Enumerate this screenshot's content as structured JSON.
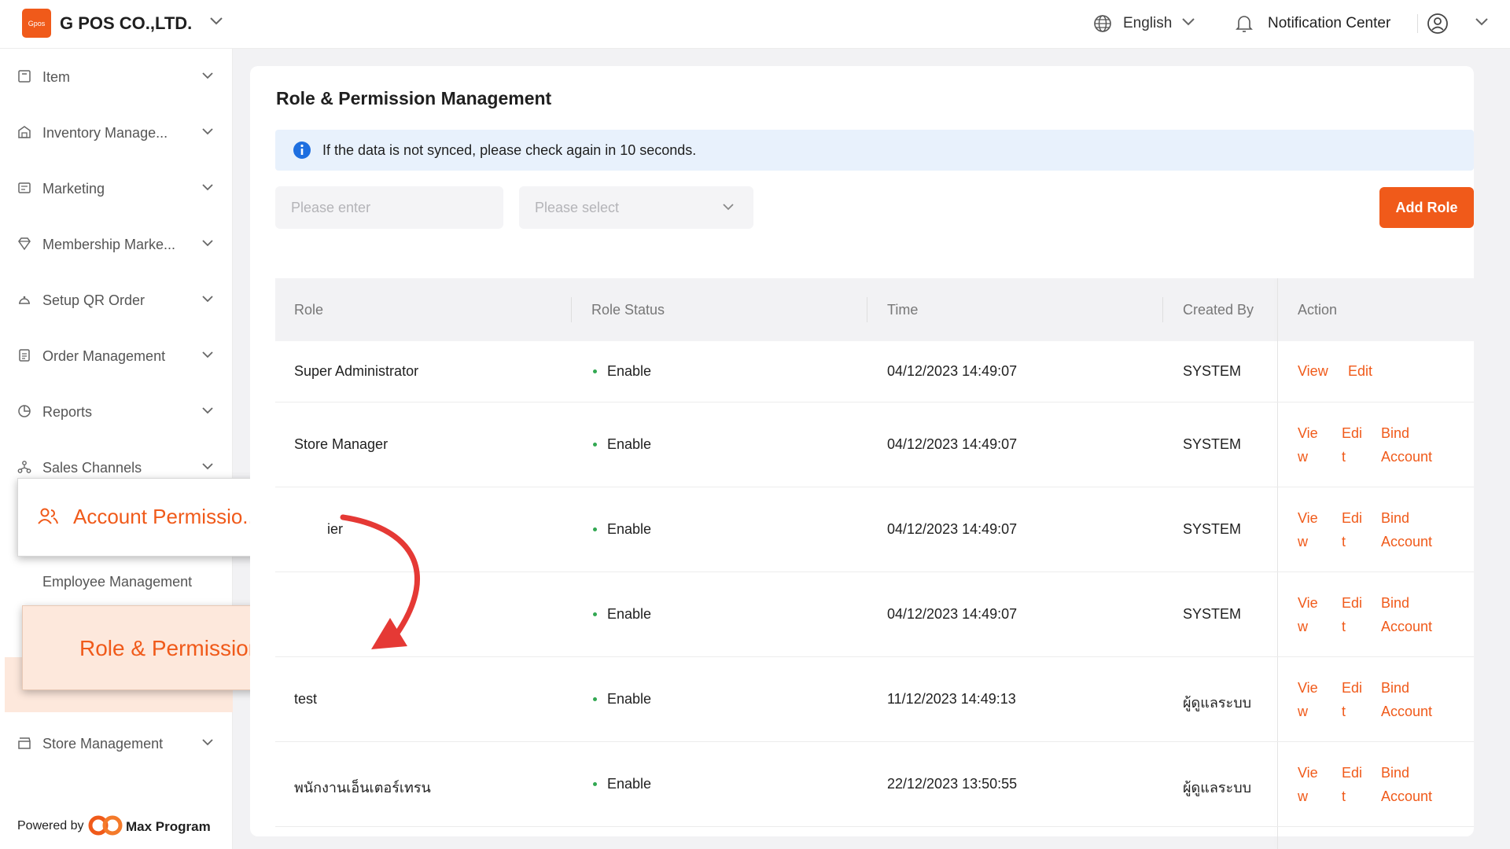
{
  "topbar": {
    "logo_text": "Gpos",
    "company": "G POS CO.,LTD.",
    "language": "English",
    "notification": "Notification Center"
  },
  "sidebar": {
    "items": [
      {
        "label": "Item",
        "icon": "box-icon"
      },
      {
        "label": "Inventory Manage...",
        "icon": "warehouse-icon"
      },
      {
        "label": "Marketing",
        "icon": "ticket-icon"
      },
      {
        "label": "Membership Marke...",
        "icon": "diamond-icon"
      },
      {
        "label": "Setup QR Order",
        "icon": "cloche-icon"
      },
      {
        "label": "Order Management",
        "icon": "clipboard-icon"
      },
      {
        "label": "Reports",
        "icon": "pie-chart-icon"
      },
      {
        "label": "Sales Channels",
        "icon": "network-icon"
      }
    ],
    "expanded": {
      "label": "Account Permissio...",
      "icon": "users-icon"
    },
    "sub_items": [
      "Employee Management",
      "Role & Permission Man..."
    ],
    "after": {
      "label": "Store Management",
      "icon": "store-icon"
    },
    "powered_by": "Powered by",
    "brand": "Max Program"
  },
  "main": {
    "title": "Role & Permission Management",
    "alert": "If the data is not synced, please check again in 10 seconds.",
    "search_placeholder": "Please enter",
    "select_placeholder": "Please select",
    "add_button": "Add Role",
    "columns": [
      "Role",
      "Role Status",
      "Time",
      "Created By",
      "Action"
    ],
    "rows": [
      {
        "role": "Super Administrator",
        "status": "Enable",
        "time": "04/12/2023 14:49:07",
        "created_by": "SYSTEM",
        "actions": [
          "View",
          "Edit"
        ]
      },
      {
        "role": "Store Manager",
        "status": "Enable",
        "time": "04/12/2023 14:49:07",
        "created_by": "SYSTEM",
        "actions": [
          "View",
          "Edit",
          "Bind Account"
        ]
      },
      {
        "role": "ier",
        "status": "Enable",
        "time": "04/12/2023 14:49:07",
        "created_by": "SYSTEM",
        "actions": [
          "View",
          "Edit",
          "Bind Account"
        ]
      },
      {
        "role": "",
        "status": "Enable",
        "time": "04/12/2023 14:49:07",
        "created_by": "SYSTEM",
        "actions": [
          "View",
          "Edit",
          "Bind Account"
        ]
      },
      {
        "role": "test",
        "status": "Enable",
        "time": "11/12/2023 14:49:13",
        "created_by": "ผู้ดูแลระบบ",
        "actions": [
          "View",
          "Edit",
          "Bind Account"
        ]
      },
      {
        "role": "พนักงานเอ็นเตอร์เทรน",
        "status": "Enable",
        "time": "22/12/2023 13:50:55",
        "created_by": "ผู้ดูแลระบบ",
        "actions": [
          "View",
          "Edit",
          "Bind Account"
        ]
      }
    ],
    "wrapped_actions": {
      "view": [
        "Vie",
        "w"
      ],
      "edit": [
        "Edi",
        "t"
      ],
      "bind": [
        "Bind",
        "Account"
      ]
    }
  },
  "colors": {
    "accent": "#f05a1a",
    "alert_bg": "#e8f1fc",
    "info": "#1e6fe0",
    "status_dot": "#32a852",
    "annotation": "#e53935"
  }
}
